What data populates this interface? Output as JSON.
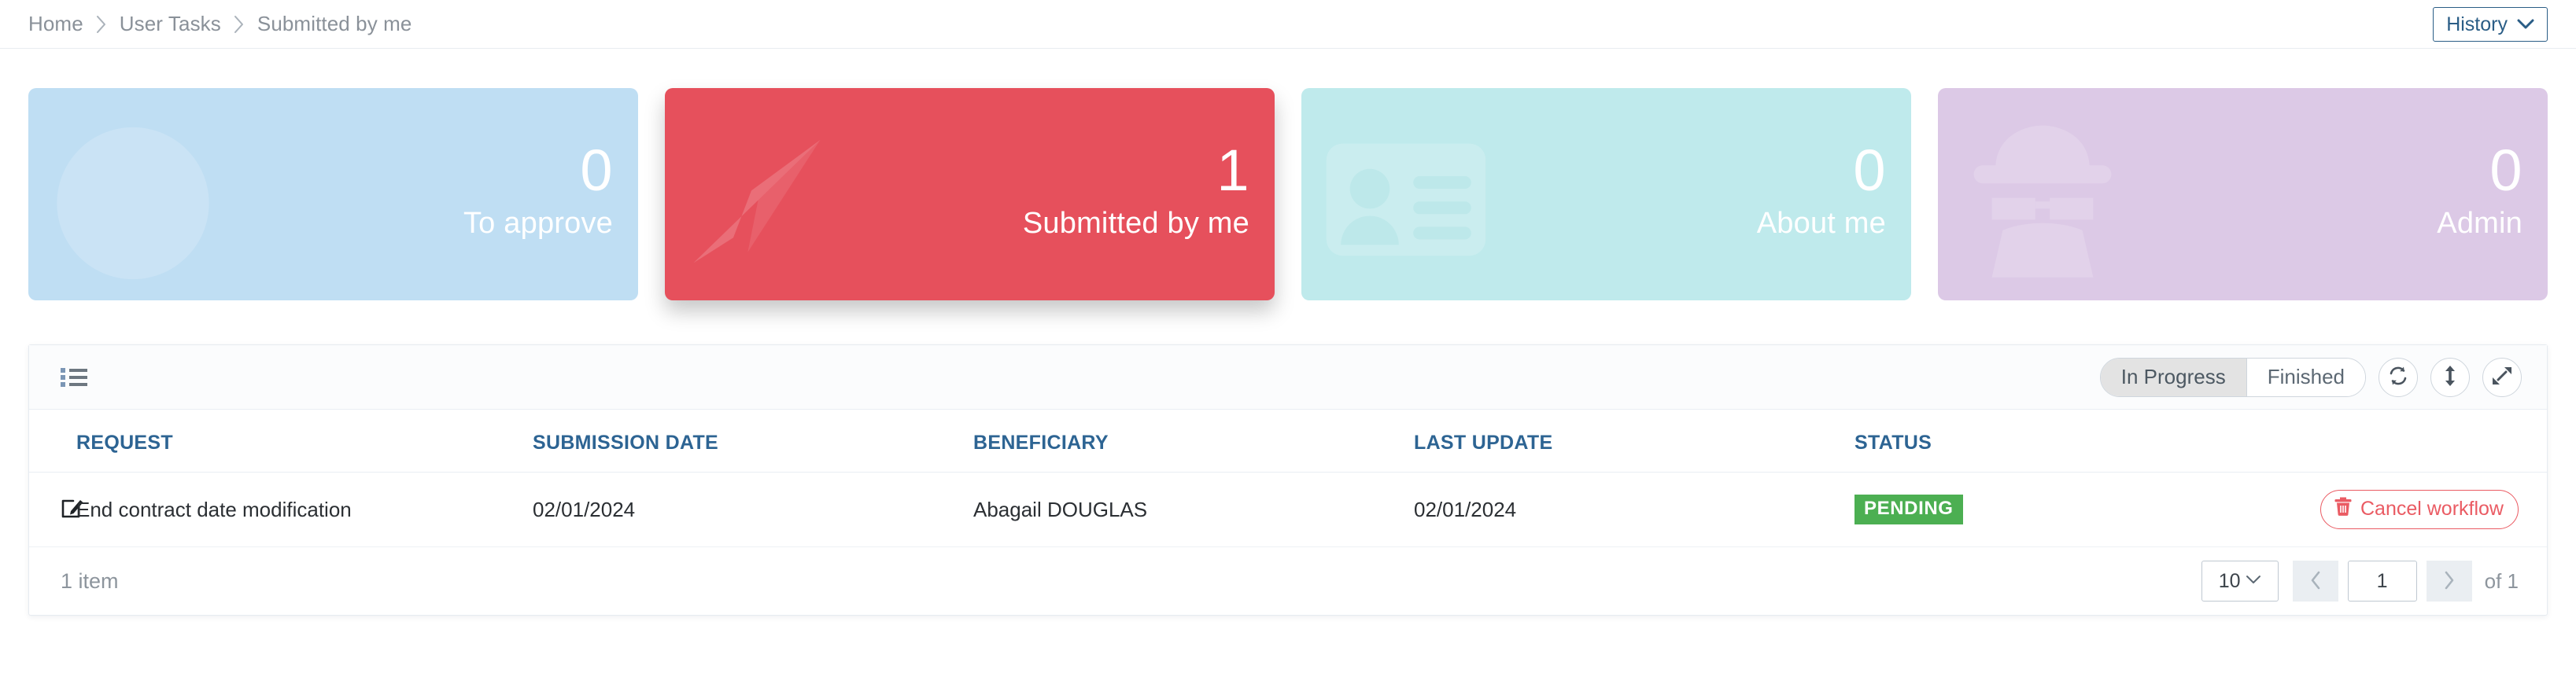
{
  "breadcrumb": {
    "items": [
      {
        "label": "Home"
      },
      {
        "label": "User Tasks"
      },
      {
        "label": "Submitted by me"
      }
    ],
    "separator": "›"
  },
  "header": {
    "history_label": "History"
  },
  "cards": [
    {
      "value": "0",
      "label": "To approve",
      "bg": "#bfdef3",
      "icon": "check-circle-icon",
      "active": false
    },
    {
      "value": "1",
      "label": "Submitted by me",
      "bg": "#e6505c",
      "icon": "paper-plane-icon",
      "active": true
    },
    {
      "value": "0",
      "label": "About me",
      "bg": "#bfeaec",
      "icon": "id-card-icon",
      "active": false
    },
    {
      "value": "0",
      "label": "Admin",
      "bg": "#dcc9e6",
      "icon": "detective-icon",
      "active": false
    }
  ],
  "toolbar": {
    "list_icon": "list-icon",
    "filters": [
      {
        "label": "In Progress",
        "active": true
      },
      {
        "label": "Finished",
        "active": false
      }
    ],
    "actions": [
      {
        "icon": "refresh-icon"
      },
      {
        "icon": "expand-rows-icon"
      },
      {
        "icon": "fullscreen-icon"
      }
    ]
  },
  "table": {
    "columns": [
      "REQUEST",
      "SUBMISSION DATE",
      "BENEFICIARY",
      "LAST UPDATE",
      "STATUS"
    ],
    "rows": [
      {
        "row_icon": "edit-icon",
        "request": "End contract date modification",
        "submission_date": "02/01/2024",
        "beneficiary": "Abagail DOUGLAS",
        "last_update": "02/01/2024",
        "status": "PENDING",
        "status_color": "#4caf52",
        "action_label": "Cancel workflow",
        "action_icon": "trash-icon",
        "action_color": "#ea5b63"
      }
    ]
  },
  "footer": {
    "item_count": "1 item",
    "page_size": "10",
    "current_page": "1",
    "total_pages_label": "of 1",
    "prev_icon": "chevron-left-icon",
    "next_icon": "chevron-right-icon"
  }
}
